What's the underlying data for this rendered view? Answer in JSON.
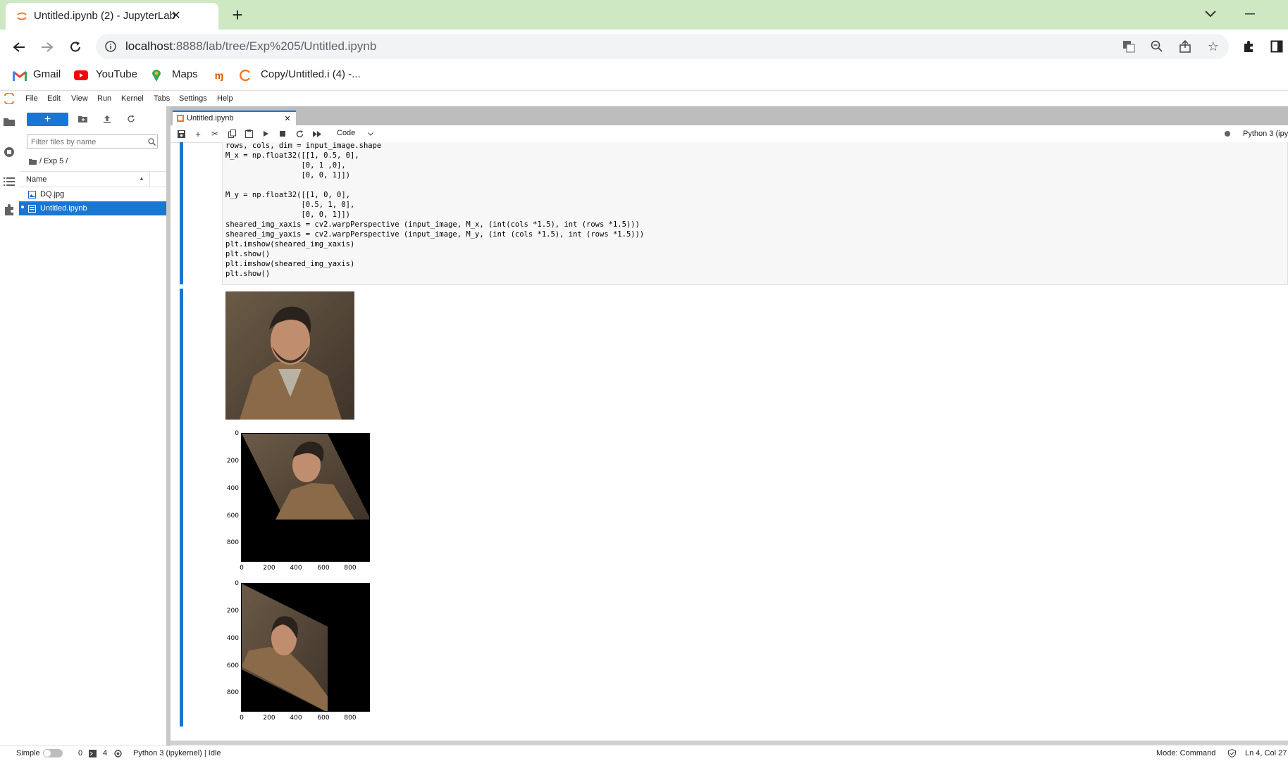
{
  "browser": {
    "tab_title": "Untitled.ipynb (2) - JupyterLab",
    "url_host": "localhost",
    "url_rest": ":8888/lab/tree/Exp%205/Untitled.ipynb",
    "bookmarks": [
      "Gmail",
      "YouTube",
      "Maps",
      "",
      "Copy/Untitled.i (4) -..."
    ]
  },
  "menu": [
    "File",
    "Edit",
    "View",
    "Run",
    "Kernel",
    "Tabs",
    "Settings",
    "Help"
  ],
  "filebrowser": {
    "filter_placeholder": "Filter files by name",
    "breadcrumb": "/ Exp 5 /",
    "column_name": "Name",
    "files": [
      {
        "name": "DQ.jpg",
        "selected": false
      },
      {
        "name": "Untitled.ipynb",
        "selected": true
      }
    ]
  },
  "doc_tab": {
    "title": "Untitled.ipynb"
  },
  "nb_toolbar": {
    "cell_type": "Code",
    "kernel": "Python 3 (ipy"
  },
  "code_lines": [
    "rows, cols, dim = input_image.shape",
    "M_x = np.float32([[1, 0.5, 0],",
    "                 [0, 1 ,0],",
    "                 [0, 0, 1]])",
    "",
    "M_y = np.float32([[1, 0, 0],",
    "                 [0.5, 1, 0],",
    "                 [0, 0, 1]])",
    "sheared_img_xaxis = cv2.warpPerspective (input_image, M_x, (int(cols *1.5), int (rows *1.5)))",
    "sheared_img_yaxis = cv2.warpPerspective (input_image, M_y, (int (cols *1.5), int (rows *1.5)))",
    "plt.imshow(sheared_img_xaxis)",
    "plt.show()",
    "plt.imshow(sheared_img_yaxis)",
    "plt.show()"
  ],
  "plots": [
    {
      "y_ticks": [
        "0",
        "200",
        "400",
        "600",
        "800"
      ],
      "x_ticks": [
        "0",
        "200",
        "400",
        "600",
        "800"
      ]
    },
    {
      "y_ticks": [
        "0",
        "200",
        "400",
        "600",
        "800"
      ],
      "x_ticks": [
        "0",
        "200",
        "400",
        "600",
        "800"
      ]
    }
  ],
  "status": {
    "mode_label": "Simple",
    "count_a": "0",
    "count_b": "4",
    "kernel_status": "Python 3 (ipykernel) | Idle",
    "mode": "Mode: Command",
    "position": "Ln 4, Col 27"
  }
}
